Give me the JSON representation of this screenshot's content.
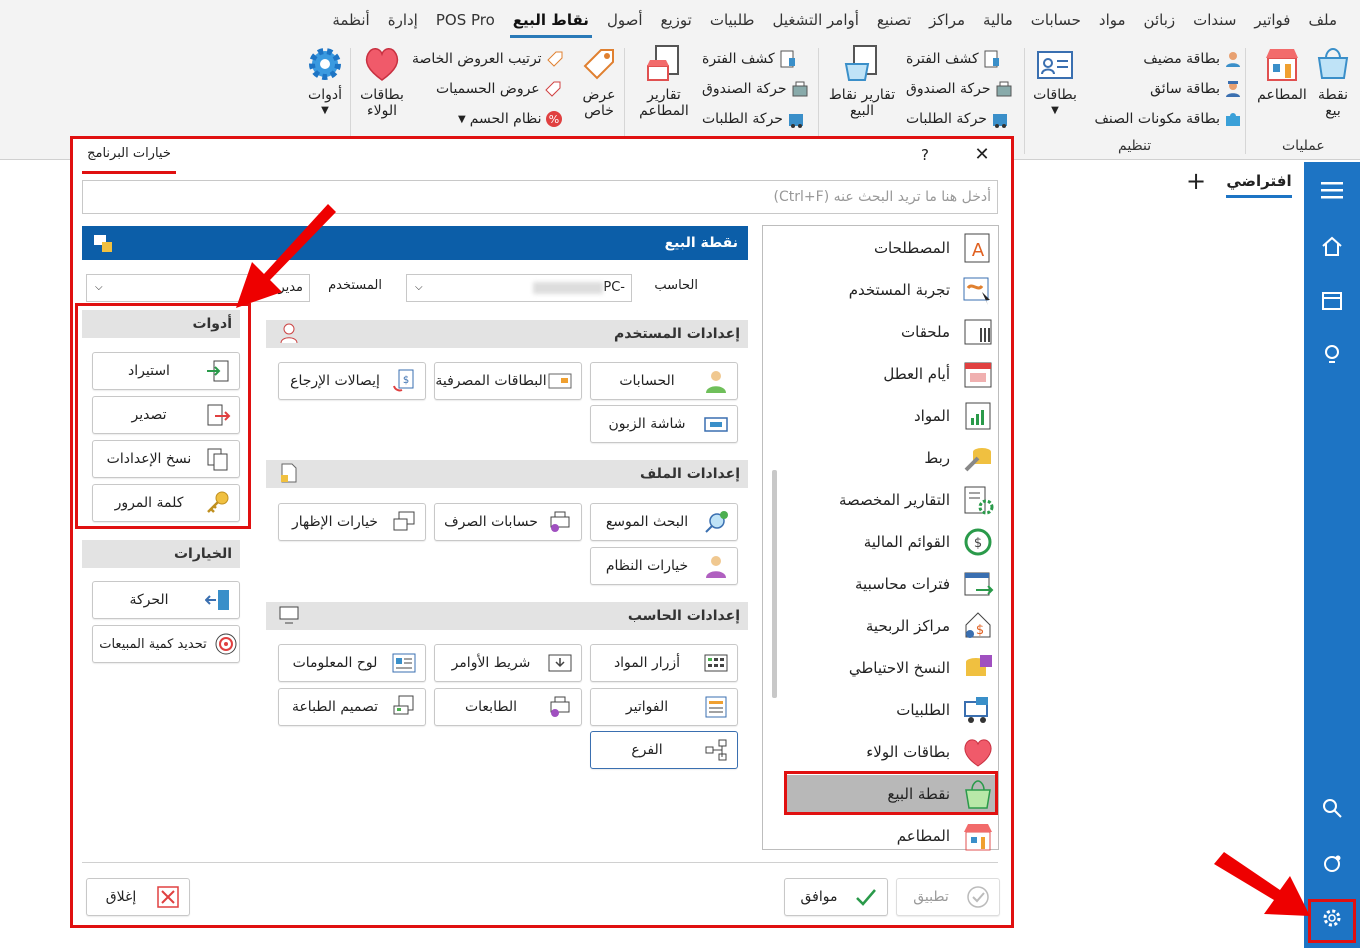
{
  "menu": [
    "ملف",
    "فواتير",
    "سندات",
    "زبائن",
    "مواد",
    "حسابات",
    "مالية",
    "مراكز",
    "تصنيع",
    "أوامر التشغيل",
    "طلبيات",
    "توزيع",
    "أصول",
    "نقاط البيع",
    "POS Pro",
    "إدارة",
    "أنظمة"
  ],
  "menu_active": "نقاط البيع",
  "ribbon": {
    "pos_point": "نقطة بيع",
    "restaurants": "المطاعم",
    "group_operations": "عمليات",
    "guest_card": "بطاقة مضيف",
    "driver_card": "بطاقة سائق",
    "item_components_card": "بطاقة مكونات الصنف",
    "cards": "بطاقات",
    "group_organization": "تنظيم",
    "period_report_1": "كشف الفترة",
    "cash_movement_1": "حركة الصندوق",
    "orders_movement_1": "حركة الطلبات",
    "pos_reports": "تقارير نقاط البيع",
    "period_report_2": "كشف الفترة",
    "cash_movement_2": "حركة الصندوق",
    "orders_movement_2": "حركة الطلبات",
    "restaurant_reports": "تقارير المطاعم",
    "special_offer": "عرض خاص",
    "special_offers_order": "ترتيب العروض الخاصة",
    "discount_offers": "عروض الحسميات",
    "discount_system": "نظام الحسم",
    "loyalty_cards": "بطاقات الولاء",
    "tools": "أدوات"
  },
  "tabs": {
    "default": "افتراضي",
    "add": "+"
  },
  "dialog": {
    "title": "خيارات البرنامج",
    "help": "?",
    "close": "✕",
    "search_placeholder": "أدخل هنا ما تريد البحث عنه (Ctrl+F)",
    "header": "نقطة البيع",
    "computer_label": "الحاسب",
    "computer_value": "-PC",
    "user_label": "المستخدم",
    "user_value": "مدير"
  },
  "categories": [
    "المصطلحات",
    "تجربة المستخدم",
    "ملحقات",
    "أيام العطل",
    "المواد",
    "ربط",
    "التقارير المخصصة",
    "القوائم المالية",
    "فترات محاسبية",
    "مراكز الربحية",
    "النسخ الاحتياطي",
    "الطلبيات",
    "بطاقات الولاء",
    "نقطة البيع",
    "المطاعم"
  ],
  "categories_selected": "نقطة البيع",
  "sections": {
    "user": "إعدادات المستخدم",
    "file": "إعدادات الملف",
    "computer": "إعدادات الحاسب"
  },
  "buttons": {
    "accounts": "الحسابات",
    "bank_cards": "البطاقات المصرفية",
    "return_receipts": "إيصالات الإرجاع",
    "customer_screen": "شاشة الزبون",
    "extended_search": "البحث الموسع",
    "exchange_accounts": "حسابات الصرف",
    "display_options": "خيارات الإظهار",
    "system_options": "خيارات النظام",
    "item_buttons": "أزرار المواد",
    "command_bar": "شريط الأوامر",
    "info_board": "لوح المعلومات",
    "invoices": "الفواتير",
    "printers": "الطابعات",
    "print_design": "تصميم الطباعة",
    "branch": "الفرع"
  },
  "tools": {
    "title": "أدوات",
    "import": "استيراد",
    "export": "تصدير",
    "copy_settings": "نسخ الإعدادات",
    "password": "كلمة المرور"
  },
  "options": {
    "title": "الخيارات",
    "movement": "الحركة",
    "sales_qty": "تحديد كمية المبيعات"
  },
  "footer": {
    "apply": "تطبيق",
    "ok": "موافق",
    "close": "إغلاق"
  },
  "colors": {
    "accent": "#0c5ea8",
    "sidebar": "#1d74c4",
    "highlight": "#e01010"
  }
}
